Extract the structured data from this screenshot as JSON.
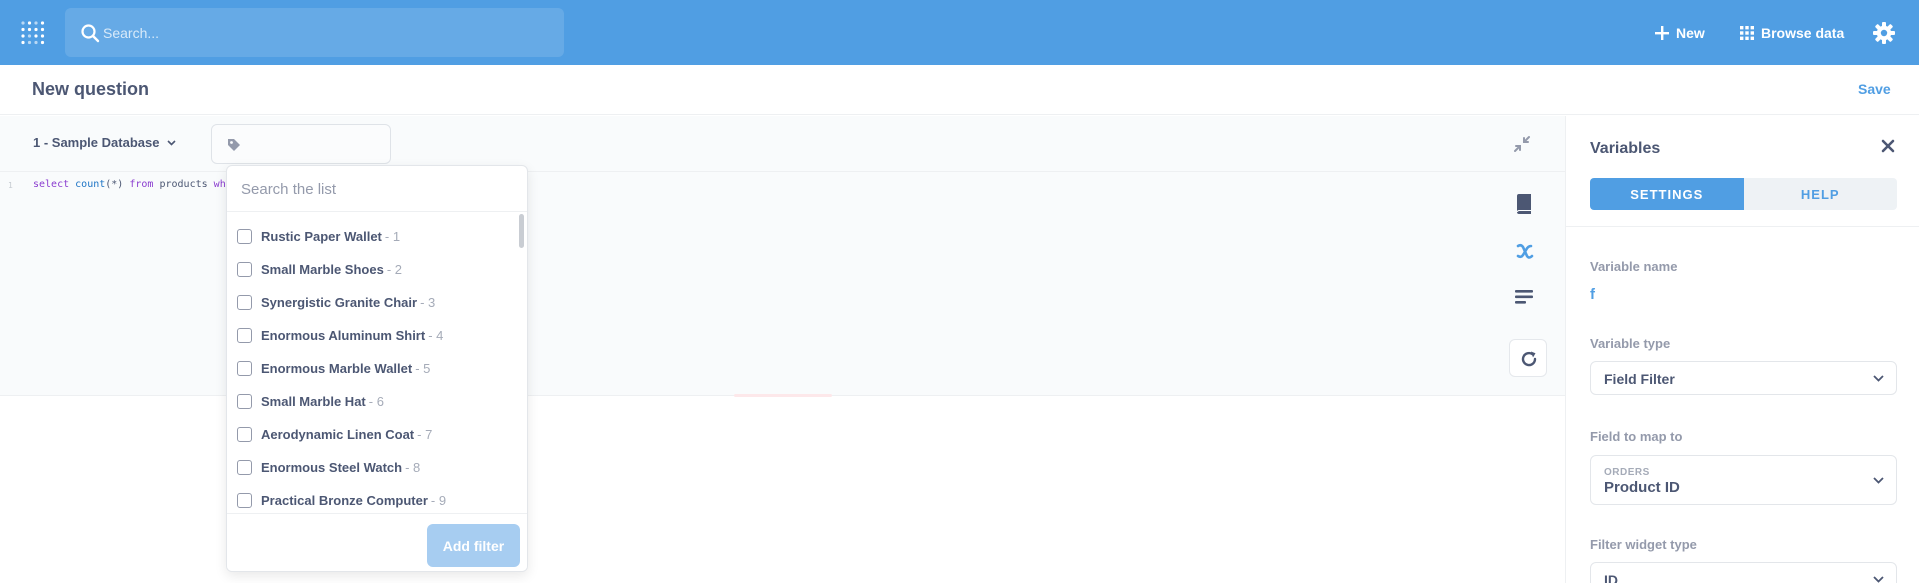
{
  "nav": {
    "search_placeholder": "Search...",
    "new_label": "New",
    "browse_label": "Browse data"
  },
  "header": {
    "title": "New question",
    "save_label": "Save"
  },
  "editor": {
    "database_label": "1 - Sample Database",
    "line_number": "1",
    "code": {
      "kw1": "select",
      "fn1": "count",
      "t1": "(*) ",
      "kw2": "from",
      "t2": " products ",
      "kw3": "wh"
    }
  },
  "dropdown": {
    "search_placeholder": "Search the list",
    "options": [
      {
        "label": "Rustic Paper Wallet",
        "id": "- 1"
      },
      {
        "label": "Small Marble Shoes",
        "id": "- 2"
      },
      {
        "label": "Synergistic Granite Chair",
        "id": "- 3"
      },
      {
        "label": "Enormous Aluminum Shirt",
        "id": "- 4"
      },
      {
        "label": "Enormous Marble Wallet",
        "id": "- 5"
      },
      {
        "label": "Small Marble Hat",
        "id": "- 6"
      },
      {
        "label": "Aerodynamic Linen Coat",
        "id": "- 7"
      },
      {
        "label": "Enormous Steel Watch",
        "id": "- 8"
      },
      {
        "label": "Practical Bronze Computer",
        "id": "- 9"
      }
    ],
    "add_filter_label": "Add filter"
  },
  "variables_panel": {
    "title": "Variables",
    "tabs": [
      "SETTINGS",
      "HELP"
    ],
    "variable_name_label": "Variable name",
    "variable_name_value": "f",
    "variable_type_label": "Variable type",
    "variable_type_value": "Field Filter",
    "field_map_label": "Field to map to",
    "field_map_table": "ORDERS",
    "field_map_value": "Product ID",
    "widget_type_label": "Filter widget type",
    "widget_type_value": "ID"
  },
  "colors": {
    "brand": "#509ee3",
    "text_dark": "#4c5773",
    "text_light": "#949aab",
    "button_disabled": "#a7cdf1"
  },
  "icons": [
    "metabase-logo-icon",
    "search-icon",
    "plus-icon",
    "grid-icon",
    "gear-icon",
    "chevron-down-icon",
    "tag-icon",
    "collapse-icon",
    "book-icon",
    "variable-x-icon",
    "snippet-icon",
    "refresh-icon",
    "close-icon"
  ]
}
